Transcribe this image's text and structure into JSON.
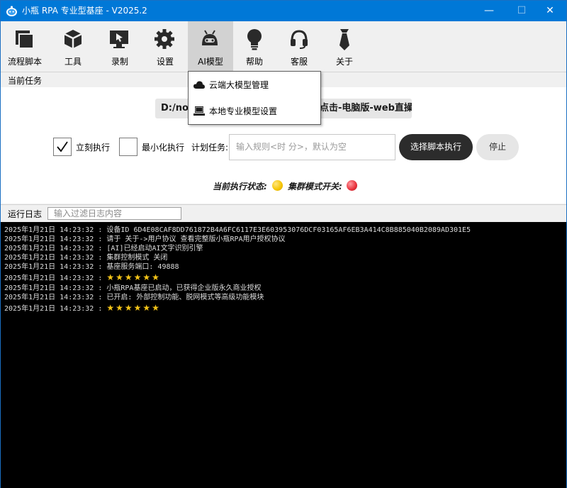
{
  "window": {
    "title": "小瓶 RPA 专业型基座 - V2025.2",
    "minimize": "—",
    "maximize": "☐",
    "close": "✕"
  },
  "toolbar": {
    "items": [
      {
        "label": "流程脚本",
        "icon": "script-icon"
      },
      {
        "label": "工具",
        "icon": "cube-icon"
      },
      {
        "label": "录制",
        "icon": "record-screen-icon"
      },
      {
        "label": "设置",
        "icon": "gear-icon"
      },
      {
        "label": "AI模型",
        "icon": "android-robot-icon"
      },
      {
        "label": "帮助",
        "icon": "lightbulb-icon"
      },
      {
        "label": "客服",
        "icon": "headset-icon"
      },
      {
        "label": "关于",
        "icon": "tie-icon"
      }
    ],
    "active": "AI模型"
  },
  "task": {
    "section_label": "当前任务",
    "script_path": "D:/nod",
    "script_path_tail": "点击-电脑版-web直操.js",
    "immediate_label": "立刻执行",
    "immediate_checked": true,
    "minimize_label": "最小化执行",
    "minimize_checked": false,
    "plan_label": "计划任务:",
    "plan_placeholder": "输入规则<时 分>，默认为空",
    "run_button": "选择脚本执行",
    "stop_button": "停止",
    "status_label": "当前执行状态:",
    "status_color": "#f5c400",
    "cluster_label": "集群模式开关:",
    "cluster_color": "#e8303a"
  },
  "ai_menu": {
    "items": [
      {
        "label": "云端大模型管理",
        "icon": "cloud-icon"
      },
      {
        "label": "本地专业模型设置",
        "icon": "computer-icon"
      }
    ]
  },
  "log": {
    "section_label": "运行日志",
    "filter_placeholder": "输入过滤日志内容",
    "lines": [
      {
        "time": "2025年1月21日 14:23:32 : ",
        "text": "设备ID 6D4E08CAF8DD761872B4A6FC6117E3E603953076DCF03165AF6EB3A414C8B885040B2089AD301E5"
      },
      {
        "time": "2025年1月21日 14:23:32 : ",
        "text": "请于 关于->用户协议 查看完整版小瓶RPA用户授权协议"
      },
      {
        "time": "2025年1月21日 14:23:32 : ",
        "text": "[AI]已经启动AI文字识别引擎"
      },
      {
        "time": "2025年1月21日 14:23:32 : ",
        "text": "集群控制模式 关闭"
      },
      {
        "time": "2025年1月21日 14:23:32 : ",
        "text": "基座服务端口: 49888"
      },
      {
        "time": "2025年1月21日 14:23:32 : ",
        "text": "★★★★★★"
      },
      {
        "time": "2025年1月21日 14:23:32 : ",
        "text": "小瓶RPA基座已启动，已获得企业版永久商业授权"
      },
      {
        "time": "2025年1月21日 14:23:32 : ",
        "text": "已开启: 外部控制功能、脱网模式等高级功能模块"
      },
      {
        "time": "2025年1月21日 14:23:32 : ",
        "text": "★★★★★★"
      }
    ]
  }
}
